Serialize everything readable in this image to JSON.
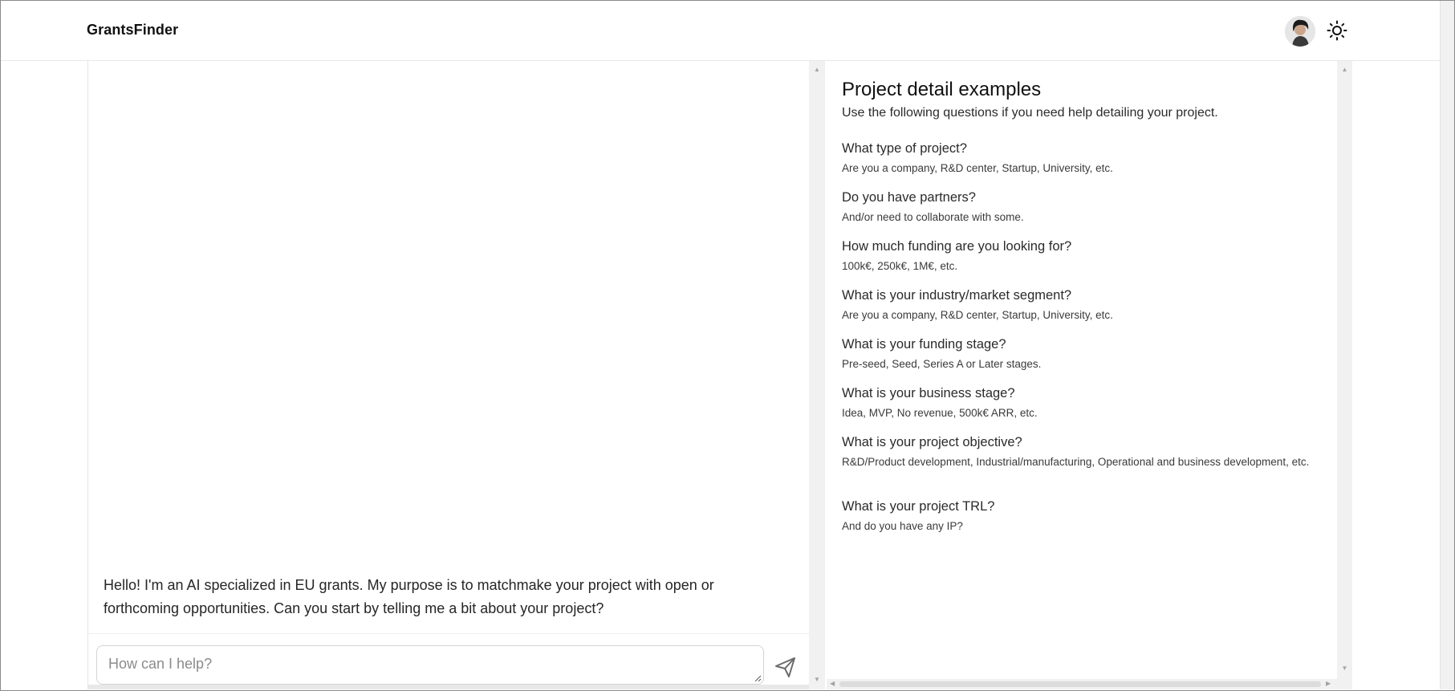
{
  "header": {
    "brand": "GrantsFinder",
    "avatar_icon": "user-avatar",
    "theme_icon": "sun-icon"
  },
  "chat": {
    "messages": [
      {
        "role": "assistant",
        "text": "Hello! I'm an AI specialized in EU grants. My purpose is to matchmake your project with open or forthcoming opportunities. Can you start by telling me a bit about your project?"
      }
    ],
    "input": {
      "placeholder": "How can I help?",
      "value": ""
    },
    "send_icon": "send-icon"
  },
  "examples": {
    "title": "Project detail examples",
    "subtitle": "Use the following questions if you need help detailing your project.",
    "items": [
      {
        "question": "What type of project?",
        "hint": "Are you a company, R&D center, Startup, University, etc."
      },
      {
        "question": "Do you have partners?",
        "hint": "And/or need to collaborate with some."
      },
      {
        "question": "How much funding are you looking for?",
        "hint": "100k€, 250k€, 1M€, etc."
      },
      {
        "question": "What is your industry/market segment?",
        "hint": "Are you a company, R&D center, Startup, University, etc."
      },
      {
        "question": "What is your funding stage?",
        "hint": "Pre-seed, Seed, Series A or Later stages."
      },
      {
        "question": "What is your business stage?",
        "hint": "Idea, MVP, No revenue, 500k€ ARR, etc."
      },
      {
        "question": "What is your project objective?",
        "hint": "R&D/Product development, Industrial/manufacturing, Operational and business development, etc."
      },
      {
        "question": "What is your project TRL?",
        "hint": "And do you have any IP?"
      }
    ]
  }
}
